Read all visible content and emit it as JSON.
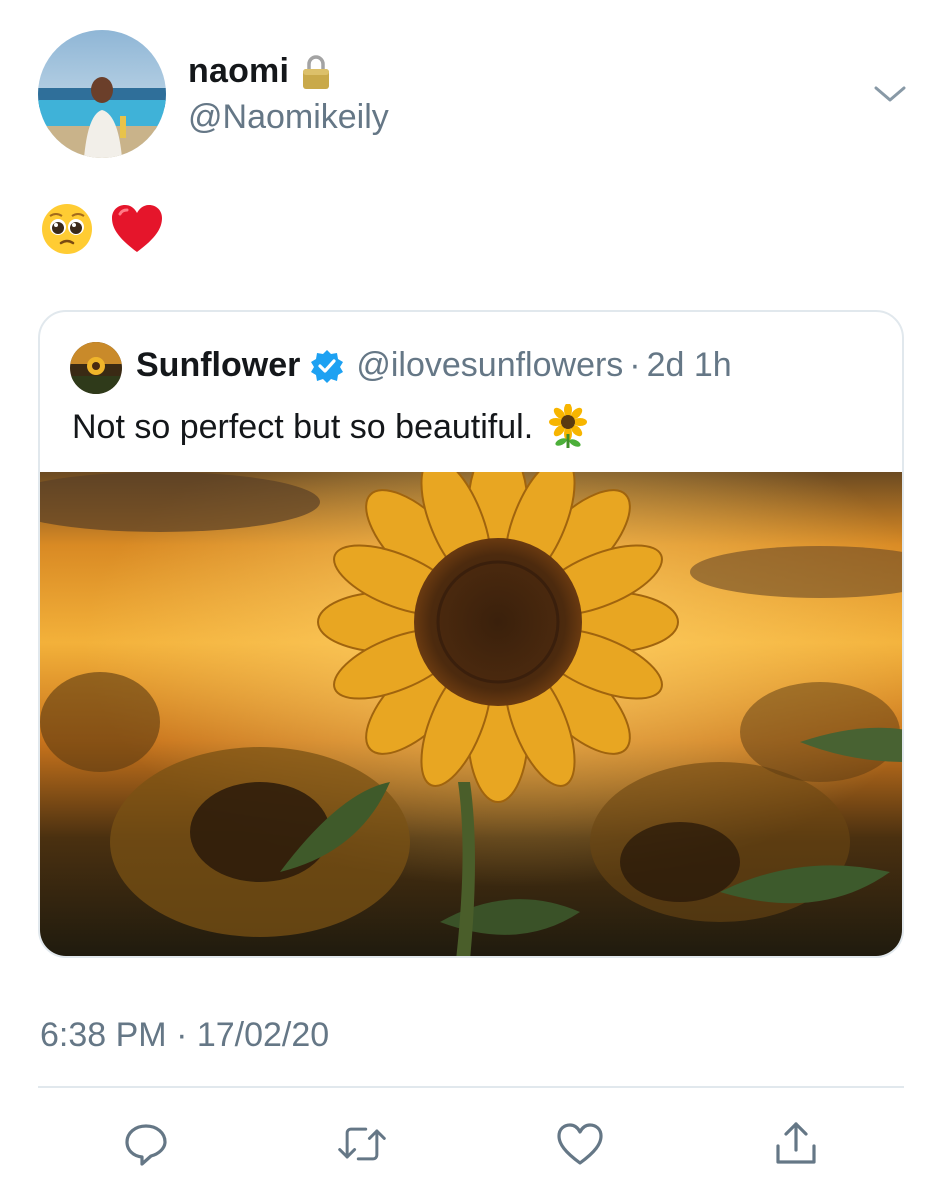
{
  "author": {
    "display_name": "naomi",
    "handle": "@Naomikeily",
    "protected_icon": "lock-icon"
  },
  "tweet": {
    "emojis": [
      "pleading-face",
      "red-heart"
    ]
  },
  "quoted_tweet": {
    "display_name": "Sunflower",
    "verified_icon": "verified-badge-icon",
    "handle": "@ilovesunflowers",
    "separator": "·",
    "time_ago": "2d 1h",
    "text": "Not so perfect but so beautiful.",
    "text_emoji": "sunflower",
    "image": "sunflower-at-sunset-photo"
  },
  "timestamp": "6:38 PM · 17/02/20",
  "actions": [
    "reply-icon",
    "retweet-icon",
    "like-icon",
    "share-icon"
  ],
  "colors": {
    "text_primary": "#14171a",
    "text_secondary": "#657786",
    "border": "#e1e8ed",
    "verified_blue": "#1da1f2",
    "icon_gray": "#657786"
  }
}
